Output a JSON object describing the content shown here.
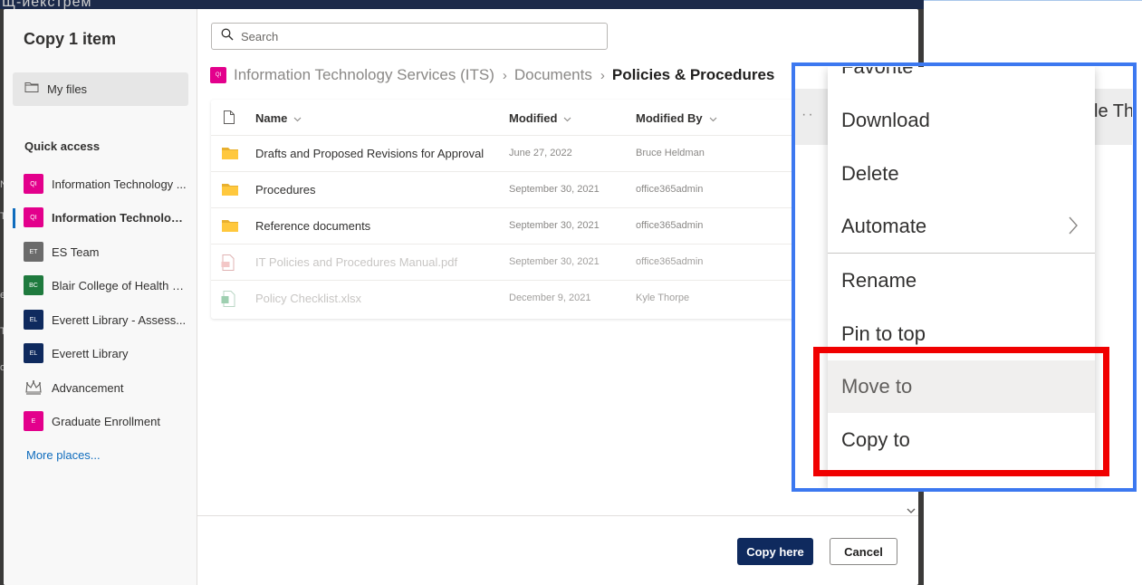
{
  "background": {
    "fragment_text": "Щ-йекстрем",
    "left_letters": [
      "N",
      "T",
      "e",
      "T",
      "o"
    ]
  },
  "dialog": {
    "title": "Copy 1 item",
    "my_files_label": "My files",
    "quick_access_heading": "Quick access",
    "quick_access": [
      {
        "label": "Information Technology ...",
        "badge": "QI",
        "color": "#e3008c",
        "selected": false
      },
      {
        "label": "Information Technolog...",
        "badge": "QI",
        "color": "#e3008c",
        "selected": true
      },
      {
        "label": "ES Team",
        "badge": "ET",
        "color": "#6b6b6b",
        "selected": false
      },
      {
        "label": "Blair College of Health - ...",
        "badge": "BC",
        "color": "#1f7a3e",
        "selected": false
      },
      {
        "label": "Everett Library - Assess...",
        "badge": "EL",
        "color": "#0f2a5e",
        "selected": false
      },
      {
        "label": "Everett Library",
        "badge": "EL",
        "color": "#0f2a5e",
        "selected": false
      },
      {
        "label": "Advancement",
        "badge": "",
        "color": "",
        "selected": false
      },
      {
        "label": "Graduate Enrollment",
        "badge": "E",
        "color": "#e3008c",
        "selected": false
      }
    ],
    "more_places": "More places...",
    "search_placeholder": "Search",
    "breadcrumb": {
      "site_badge": "QI",
      "items": [
        "Information Technology Services (ITS)",
        "Documents",
        "Policies & Procedures"
      ]
    },
    "columns": {
      "name": "Name",
      "modified": "Modified",
      "modified_by": "Modified By"
    },
    "rows": [
      {
        "name": "Drafts and Proposed Revisions for Approval",
        "modified": "June 27, 2022",
        "modified_by": "Bruce Heldman",
        "type": "folder"
      },
      {
        "name": "Procedures",
        "modified": "September 30, 2021",
        "modified_by": "office365admin",
        "type": "folder"
      },
      {
        "name": "Reference documents",
        "modified": "September 30, 2021",
        "modified_by": "office365admin",
        "type": "folder"
      },
      {
        "name": "IT Policies and Procedures Manual.pdf",
        "modified": "September 30, 2021",
        "modified_by": "office365admin",
        "type": "pdf"
      },
      {
        "name": "Policy Checklist.xlsx",
        "modified": "December 9, 2021",
        "modified_by": "Kyle Thorpe",
        "type": "xlsx"
      }
    ],
    "copy_here": "Copy here",
    "cancel": "Cancel"
  },
  "context_menu": {
    "behind_text": "yle Th",
    "items": [
      "Favorite",
      "Download",
      "Delete",
      "Automate",
      "Rename",
      "Pin to top",
      "Move to",
      "Copy to"
    ]
  },
  "annotations": {
    "blue_box_color": "#3c78f0",
    "red_box_color": "#f00000"
  }
}
